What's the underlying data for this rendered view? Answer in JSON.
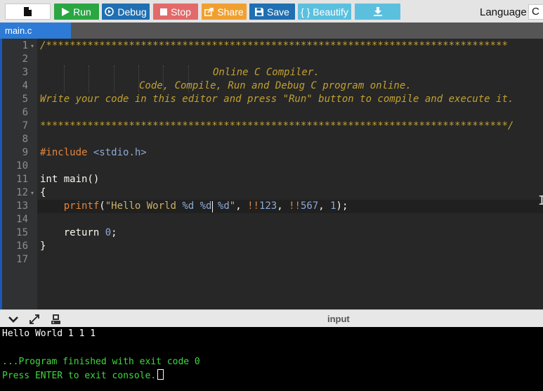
{
  "toolbar": {
    "run_label": "Run",
    "debug_label": "Debug",
    "stop_label": "Stop",
    "share_label": "Share",
    "save_label": "Save",
    "beautify_label": "{ } Beautify",
    "language_label": "Language",
    "language_value": "C"
  },
  "tabs": [
    {
      "label": "main.c"
    }
  ],
  "editor": {
    "line_numbers": [
      "1",
      "2",
      "3",
      "4",
      "5",
      "6",
      "7",
      "8",
      "9",
      "10",
      "11",
      "12",
      "13",
      "14",
      "15",
      "16",
      "17"
    ],
    "comment_border_top": "/******************************************************************************",
    "comment_title": "Online C Compiler.",
    "comment_subtitle": "Code, Compile, Run and Debug C program online.",
    "comment_instructions": "Write your code in this editor and press \"Run\" button to compile and execute it.",
    "comment_border_bottom": "*******************************************************************************/",
    "include_directive": "#include",
    "include_header": "<stdio.h>",
    "main_signature": "int main()",
    "open_brace": "{",
    "printf_fn": "printf",
    "printf_open": "(",
    "printf_str_part1": "\"Hello World ",
    "printf_fmt1": "%d",
    "printf_fmt2a": "%",
    "printf_fmt2b": "d",
    "printf_fmt3": "%d",
    "printf_str_end": "\"",
    "printf_comma1": ", ",
    "printf_not1": "!!",
    "printf_num1": "123",
    "printf_comma2": ", ",
    "printf_not2": "!!",
    "printf_num2": "567",
    "printf_comma3": ", ",
    "printf_num3": "1",
    "printf_close": ");",
    "return_kw": "return",
    "return_value": "0",
    "return_end": ";",
    "close_brace": "}"
  },
  "output": {
    "input_label": "input",
    "lines": [
      "Hello World 1 1 1",
      "",
      "...Program finished with exit code 0",
      "Press ENTER to exit console."
    ]
  },
  "colors": {
    "run": "#2aa643",
    "debug": "#1f6fb2",
    "stop": "#e26a6a",
    "share": "#f0a030",
    "save": "#1f6fb2",
    "beautify": "#5bc0de",
    "tab_active": "#2d7bd6",
    "console_info": "#3fd93f"
  },
  "icons": [
    "file-icon",
    "play-icon",
    "debug-icon",
    "stop-icon",
    "share-icon",
    "save-icon",
    "download-icon",
    "chevron-down-icon",
    "expand-icon",
    "settings-icon"
  ]
}
